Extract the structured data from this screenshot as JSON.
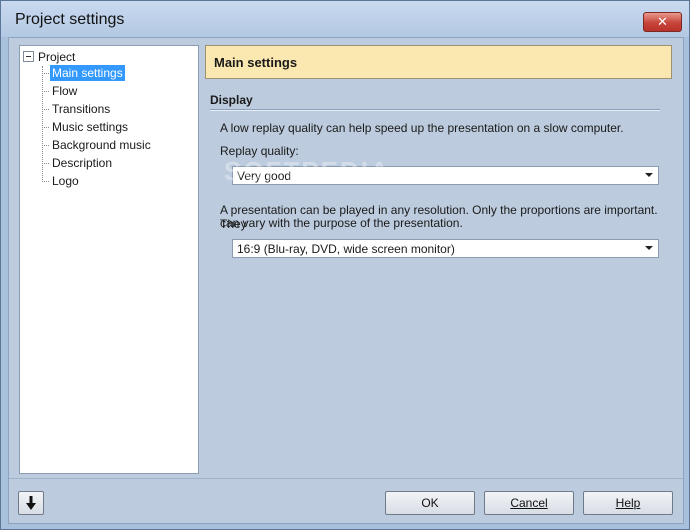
{
  "window": {
    "title": "Project settings",
    "close_glyph": "✕"
  },
  "tree": {
    "root_label": "Project",
    "items": [
      {
        "label": "Main settings",
        "selected": true
      },
      {
        "label": "Flow"
      },
      {
        "label": "Transitions"
      },
      {
        "label": "Music settings"
      },
      {
        "label": "Background music"
      },
      {
        "label": "Description"
      },
      {
        "label": "Logo"
      }
    ]
  },
  "panel": {
    "header": "Main settings",
    "section_title": "Display",
    "quality_hint": "A low replay quality can help speed up the presentation on a slow computer.",
    "quality_label": "Replay quality:",
    "quality_value": "Very good",
    "resolution_hint_line1": "A presentation can be played in any resolution. Only the proportions are important. They",
    "resolution_hint_line2": "can vary with the purpose of the presentation.",
    "resolution_value": "16:9 (Blu-ray, DVD, wide screen monitor)"
  },
  "watermark": "SOFTPEDIA",
  "buttons": {
    "down_icon": "arrow-down-icon",
    "ok": "OK",
    "cancel": "Cancel",
    "help": "Help"
  },
  "colors": {
    "selection": "#3399ff",
    "header_bg": "#fbe8b0",
    "close_red": "#c8443a",
    "background": "#bccbdd"
  }
}
